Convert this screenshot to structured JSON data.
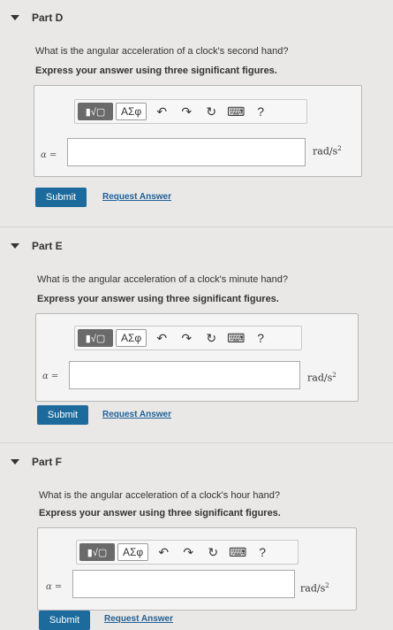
{
  "parts": [
    {
      "title": "Part D",
      "question": "What is the angular acceleration of a clock's second hand?",
      "instruction": "Express your answer using three significant figures.",
      "variable": "α =",
      "value": "",
      "unit_base": "rad/s",
      "unit_exp": "2",
      "toolbar": {
        "template": "▮√▢",
        "greek": "ΑΣφ",
        "help": "?"
      },
      "submit": "Submit",
      "request": "Request Answer"
    },
    {
      "title": "Part E",
      "question": "What is the angular acceleration of a clock's minute hand?",
      "instruction": "Express your answer using three significant figures.",
      "variable": "α =",
      "value": "",
      "unit_base": "rad/s",
      "unit_exp": "2",
      "toolbar": {
        "template": "▮√▢",
        "greek": "ΑΣφ",
        "help": "?"
      },
      "submit": "Submit",
      "request": "Request Answer"
    },
    {
      "title": "Part F",
      "question": "What is the angular acceleration of a clock's hour hand?",
      "instruction": "Express your answer using three significant figures.",
      "variable": "α =",
      "value": "",
      "unit_base": "rad/s",
      "unit_exp": "2",
      "toolbar": {
        "template": "▮√▢",
        "greek": "ΑΣφ",
        "help": "?"
      },
      "submit": "Submit",
      "request": "Request Answer"
    }
  ]
}
